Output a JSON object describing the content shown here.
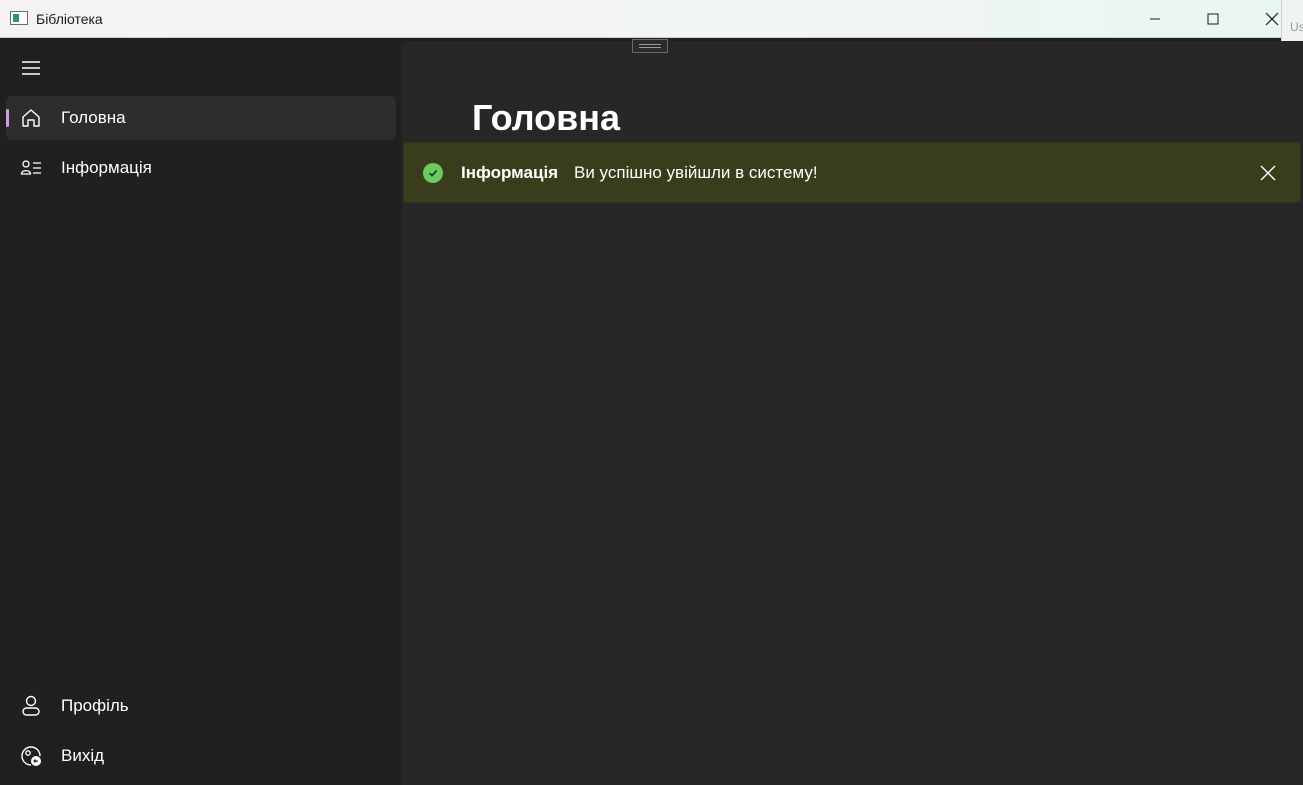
{
  "window": {
    "title": "Бібліотека",
    "right_sliver_text": "Us"
  },
  "sidebar": {
    "items": [
      {
        "label": "Головна",
        "icon": "home-icon",
        "selected": true
      },
      {
        "label": "Інформація",
        "icon": "info-list-icon",
        "selected": false
      }
    ],
    "footer_items": [
      {
        "label": "Профіль",
        "icon": "person-icon"
      },
      {
        "label": "Вихід",
        "icon": "sign-out-icon"
      }
    ]
  },
  "main": {
    "page_title": "Головна",
    "infobar": {
      "title": "Інформація",
      "message": "Ви успішно увійшли в систему!",
      "severity": "success"
    }
  },
  "colors": {
    "selection_indicator": "#d59be8",
    "success": "#6ccb5f",
    "infobar_bg": "#393d1b"
  }
}
